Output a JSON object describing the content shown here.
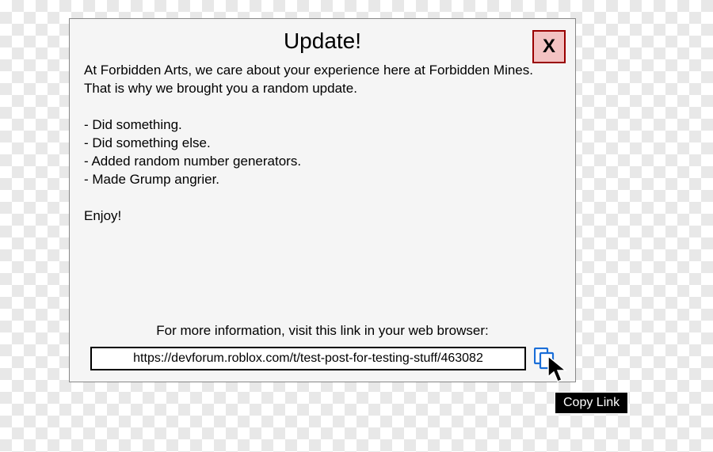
{
  "dialog": {
    "title": "Update!",
    "close_label": "X",
    "body": "At Forbidden Arts, we care about your experience here at Forbidden Mines.\nThat is why we brought you a random update.\n\n- Did something.\n- Did something else.\n- Added random number generators.\n- Made Grump angrier.\n\nEnjoy!",
    "link_label": "For more information, visit this link in your web browser:",
    "link_value": "https://devforum.roblox.com/t/test-post-for-testing-stuff/463082"
  },
  "tooltip": {
    "text": "Copy Link"
  }
}
